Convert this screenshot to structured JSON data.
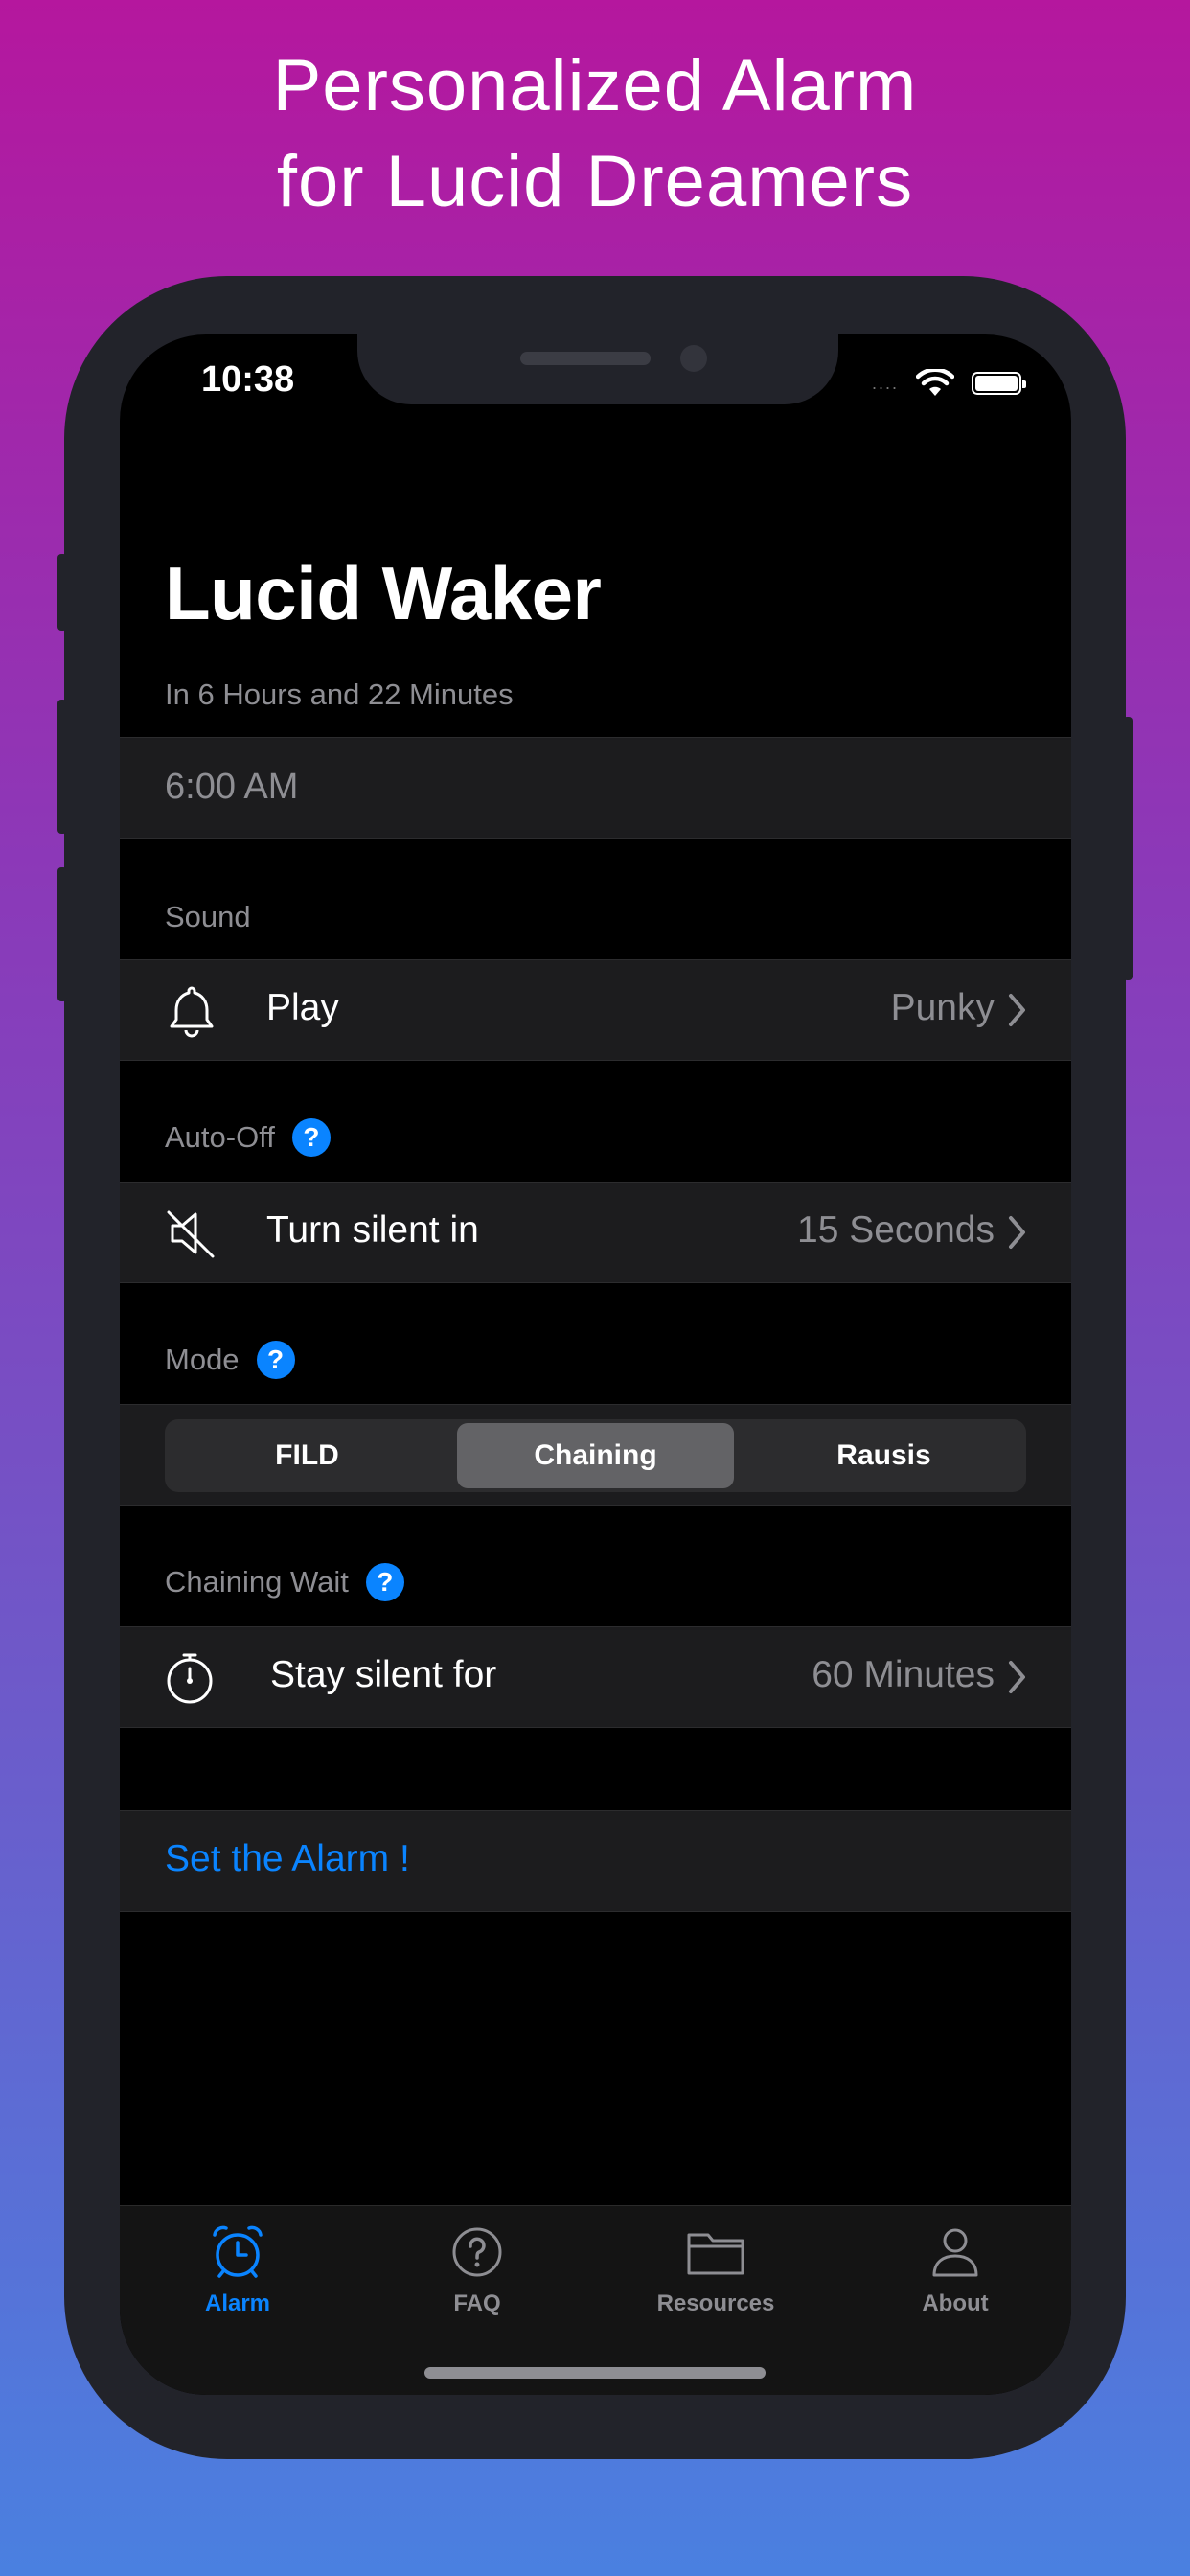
{
  "headline": {
    "line1": "Personalized Alarm",
    "line2": "for Lucid Dreamers"
  },
  "status_bar": {
    "time": "10:38",
    "signal": "....",
    "icons": [
      "wifi-icon",
      "battery-icon"
    ]
  },
  "app": {
    "title": "Lucid Waker",
    "subtitle": "In 6 Hours and 22 Minutes",
    "alarm_time": "6:00 AM"
  },
  "sound": {
    "section_label": "Sound",
    "row_label": "Play",
    "row_value": "Punky",
    "icon": "bell-icon"
  },
  "auto_off": {
    "section_label": "Auto-Off",
    "row_label": "Turn silent in",
    "row_value": "15 Seconds",
    "icon": "speaker-mute-icon"
  },
  "mode": {
    "section_label": "Mode",
    "options": [
      "FILD",
      "Chaining",
      "Rausis"
    ],
    "selected": "Chaining"
  },
  "chaining_wait": {
    "section_label": "Chaining Wait",
    "row_label": "Stay silent for",
    "row_value": "60 Minutes",
    "icon": "stopwatch-icon"
  },
  "help_glyph": "?",
  "set_alarm_label": "Set the Alarm !",
  "tabs": [
    {
      "label": "Alarm",
      "icon": "alarm-clock-icon",
      "active": true
    },
    {
      "label": "FAQ",
      "icon": "question-circle-icon",
      "active": false
    },
    {
      "label": "Resources",
      "icon": "folder-icon",
      "active": false
    },
    {
      "label": "About",
      "icon": "person-icon",
      "active": false
    }
  ],
  "colors": {
    "accent": "#0a84ff",
    "background": "#000000",
    "row": "#1c1c1e",
    "secondary_text": "#8e8e93",
    "gradient_top": "#b5179e",
    "gradient_bottom": "#4a80e0"
  }
}
